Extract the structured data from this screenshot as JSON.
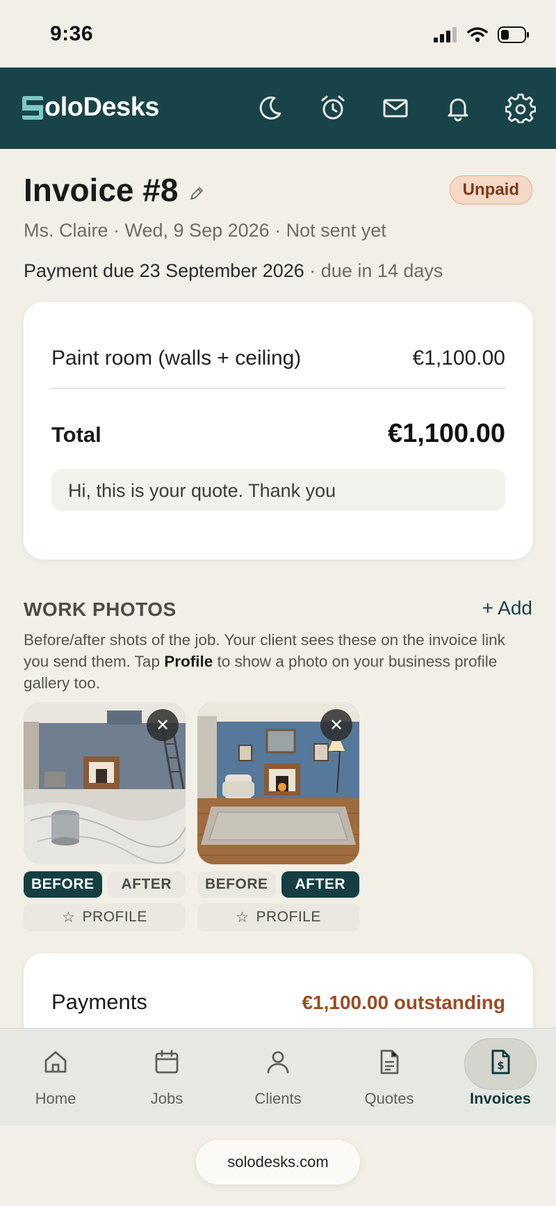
{
  "status_bar": {
    "time": "9:36"
  },
  "header": {
    "app_name": "oloDesks",
    "logo_letter": "S",
    "icons": [
      "moon-icon",
      "alarm-icon",
      "mail-icon",
      "bell-icon",
      "gear-icon"
    ],
    "brand_color": "#184449"
  },
  "invoice": {
    "title": "Invoice #8",
    "status": "Unpaid",
    "meta": "Ms. Claire · Wed, 9 Sep 2026 · Not sent yet",
    "payment_due_label": "Payment due 23 September 2026",
    "payment_due_in": "· due in 14 days",
    "line_items": [
      {
        "description": "Paint room (walls + ceiling)",
        "amount": "€1,100.00"
      }
    ],
    "total_label": "Total",
    "total_value": "€1,100.00",
    "note": "Hi, this is your quote. Thank you"
  },
  "work_photos": {
    "title": "WORK PHOTOS",
    "add_label": "+ Add",
    "desc_part1": "Before/after shots of the job. Your client sees these on the invoice link you send them. Tap ",
    "desc_bold": "Profile",
    "desc_part2": " to show a photo on your business profile gallery too.",
    "photos": [
      {
        "before_label": "BEFORE",
        "after_label": "AFTER",
        "selected": "before",
        "profile_label": "PROFILE"
      },
      {
        "before_label": "BEFORE",
        "after_label": "AFTER",
        "selected": "after",
        "profile_label": "PROFILE"
      }
    ],
    "remove_symbol": "✕",
    "star_symbol": "☆"
  },
  "payments": {
    "label": "Payments",
    "outstanding": "€1,100.00 outstanding",
    "outstanding_color": "#9e4a25"
  },
  "bottom_nav": {
    "items": [
      {
        "label": "Home",
        "icon": "home-icon"
      },
      {
        "label": "Jobs",
        "icon": "calendar-icon"
      },
      {
        "label": "Clients",
        "icon": "user-icon"
      },
      {
        "label": "Quotes",
        "icon": "document-icon"
      },
      {
        "label": "Invoices",
        "icon": "invoice-icon"
      }
    ],
    "active": "Invoices"
  },
  "url": "solodesks.com"
}
